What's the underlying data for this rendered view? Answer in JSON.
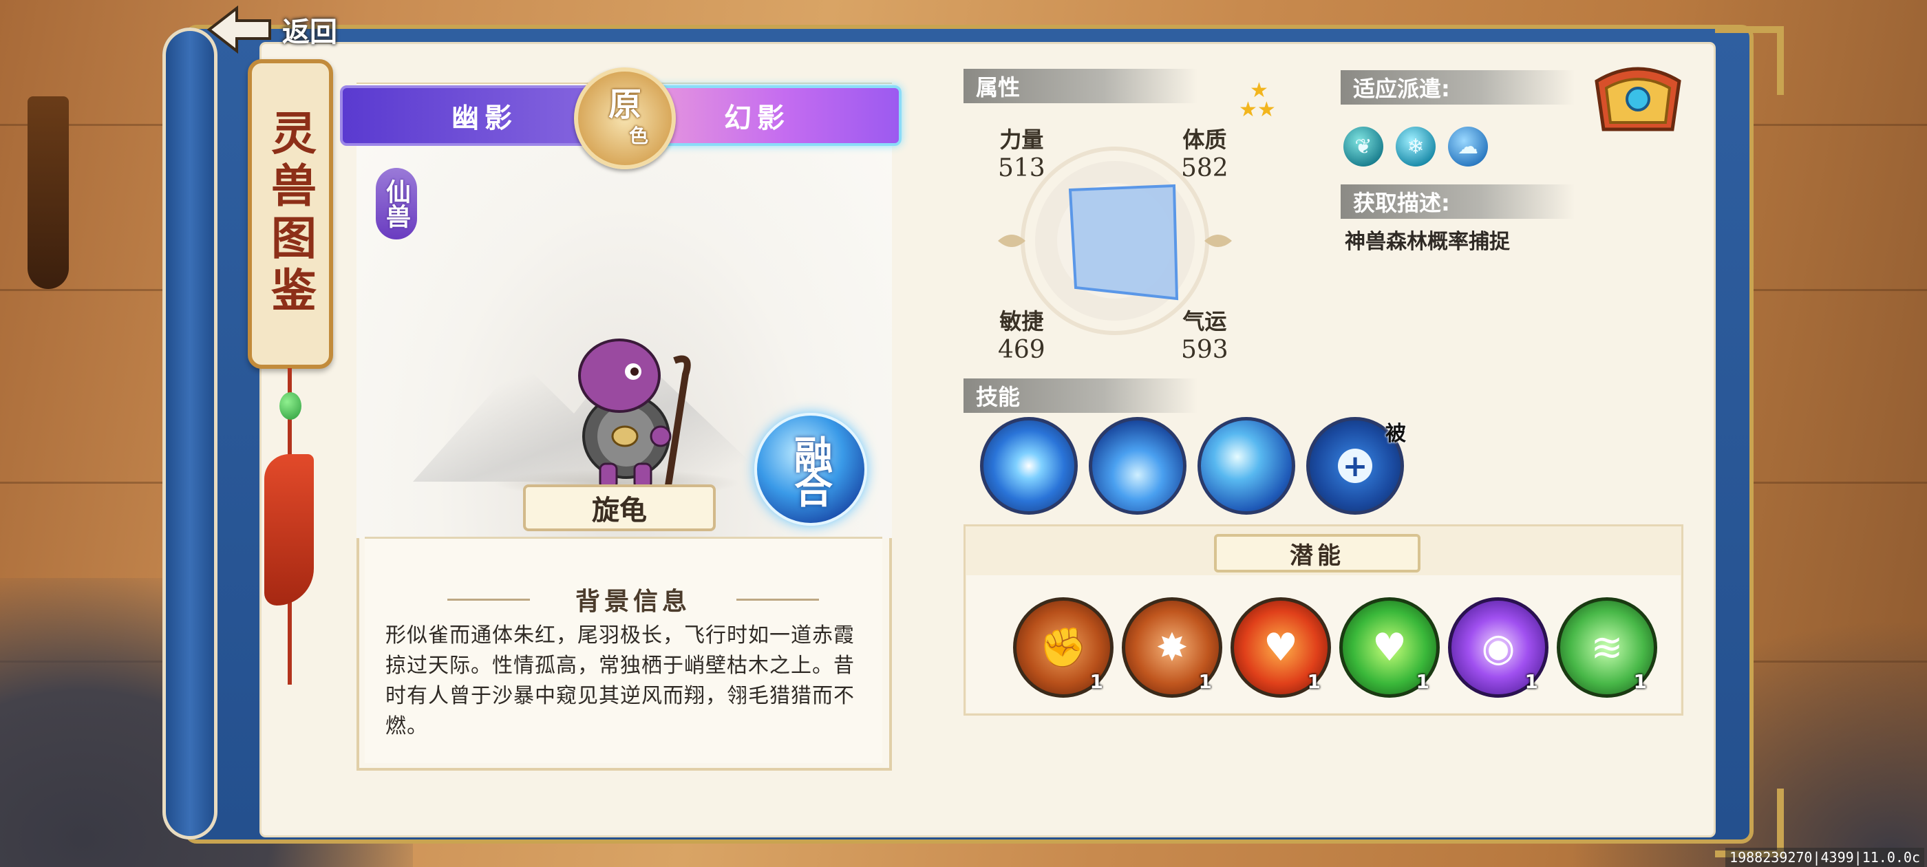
{
  "nav": {
    "back_label": "返回"
  },
  "title": "灵兽图鉴",
  "form_tabs": {
    "ghost": "幽影",
    "origin_main": "原",
    "origin_sub": "色",
    "phantom": "幻影"
  },
  "pet": {
    "rank": "仙兽",
    "name": "旋龟",
    "fuse_label": "融合"
  },
  "background": {
    "header": "背景信息",
    "text": "形似雀而通体朱红，尾羽极长，飞行时如一道赤霞掠过天际。性情孤高，常独栖于峭壁枯木之上。昔时有人曾于沙暴中窥见其逆风而翔，翎毛猎猎而不燃。"
  },
  "attributes": {
    "label": "属性",
    "star_count": 3,
    "stats": [
      {
        "key": "power",
        "label": "力量",
        "value": "513"
      },
      {
        "key": "physique",
        "label": "体质",
        "value": "582"
      },
      {
        "key": "agility",
        "label": "敏捷",
        "value": "469"
      },
      {
        "key": "luck",
        "label": "气运",
        "value": "593"
      }
    ]
  },
  "adapt": {
    "label": "适应派遣:",
    "icons": [
      "leaf-icon",
      "snowflake-icon",
      "rain-cloud-icon"
    ]
  },
  "acquire": {
    "label": "获取描述:",
    "text": "神兽森林概率捕捉"
  },
  "skills": {
    "label": "技能",
    "items": [
      {
        "icon": "blue-burst-icon"
      },
      {
        "icon": "water-wave-icon"
      },
      {
        "icon": "water-dragon-icon"
      },
      {
        "icon": "heal-shield-icon",
        "tag": "被"
      }
    ]
  },
  "potential": {
    "label": "潜能",
    "items": [
      {
        "icon": "fist-shield-icon",
        "level": "1"
      },
      {
        "icon": "strength-burst-icon",
        "level": "1"
      },
      {
        "icon": "fire-heart-icon",
        "level": "1"
      },
      {
        "icon": "green-heart-icon",
        "level": "1"
      },
      {
        "icon": "purple-eye-icon",
        "level": "1"
      },
      {
        "icon": "green-wind-icon",
        "level": "1"
      }
    ]
  },
  "footer": {
    "version": "1988239270|4399|11.0.0c"
  }
}
